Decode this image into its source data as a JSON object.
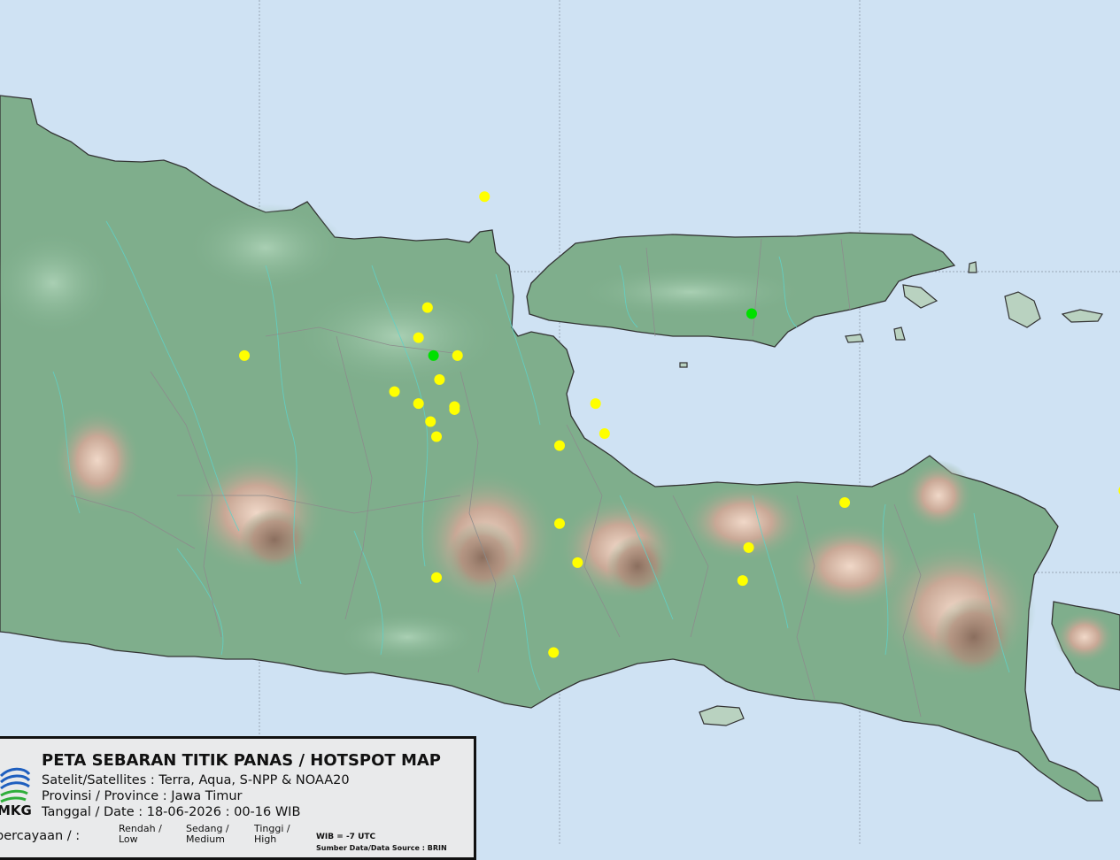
{
  "legend": {
    "title": "PETA SEBARAN TITIK PANAS / HOTSPOT MAP",
    "satellites": "Satelit/Satellites : Terra, Aqua, S-NPP & NOAA20",
    "province": "Provinsi / Province : Jawa Timur",
    "date": "Tanggal / Date : 18-06-2026 : 00-16 WIB",
    "confidence_label": "percayaan / :",
    "levels": [
      {
        "line1": "Rendah /",
        "line2": "Low"
      },
      {
        "line1": "Sedang /",
        "line2": "Medium"
      },
      {
        "line1": "Tinggi /",
        "line2": "High"
      }
    ],
    "timezone_note": "WIB = -7 UTC",
    "source_partial": "Sumber Data/Data Source : BRIN",
    "logo_text": "MKG"
  },
  "colors": {
    "sea": "#cfe2f3",
    "land": "#7fae8c",
    "river": "#5fd2c8",
    "hotspot_medium": "#ffff00",
    "hotspot_low": "#00e000",
    "coast": "#333333"
  },
  "hotspots": [
    {
      "lon": 111.75,
      "lat": -6.75,
      "level": "medium"
    },
    {
      "lon": 111.56,
      "lat": -7.12,
      "level": "medium"
    },
    {
      "lon": 111.53,
      "lat": -7.22,
      "level": "medium"
    },
    {
      "lon": 111.58,
      "lat": -7.28,
      "level": "low"
    },
    {
      "lon": 111.66,
      "lat": -7.28,
      "level": "medium"
    },
    {
      "lon": 111.6,
      "lat": -7.36,
      "level": "medium"
    },
    {
      "lon": 111.45,
      "lat": -7.4,
      "level": "medium"
    },
    {
      "lon": 111.53,
      "lat": -7.44,
      "level": "medium"
    },
    {
      "lon": 111.65,
      "lat": -7.45,
      "level": "medium"
    },
    {
      "lon": 111.65,
      "lat": -7.46,
      "level": "medium"
    },
    {
      "lon": 111.57,
      "lat": -7.5,
      "level": "medium"
    },
    {
      "lon": 111.59,
      "lat": -7.55,
      "level": "medium"
    },
    {
      "lon": 110.95,
      "lat": -7.28,
      "level": "medium"
    },
    {
      "lon": 112.12,
      "lat": -7.44,
      "level": "medium"
    },
    {
      "lon": 112.15,
      "lat": -7.54,
      "level": "medium"
    },
    {
      "lon": 112.0,
      "lat": -7.58,
      "level": "medium"
    },
    {
      "lon": 112.0,
      "lat": -7.84,
      "level": "medium"
    },
    {
      "lon": 112.06,
      "lat": -7.97,
      "level": "medium"
    },
    {
      "lon": 111.59,
      "lat": -8.02,
      "level": "medium"
    },
    {
      "lon": 111.98,
      "lat": -8.27,
      "level": "medium"
    },
    {
      "lon": 112.63,
      "lat": -7.92,
      "level": "medium"
    },
    {
      "lon": 112.61,
      "lat": -8.03,
      "level": "medium"
    },
    {
      "lon": 112.95,
      "lat": -7.77,
      "level": "medium"
    },
    {
      "lon": 112.64,
      "lat": -7.14,
      "level": "low"
    },
    {
      "lon": 113.88,
      "lat": -7.73,
      "level": "medium"
    },
    {
      "lon": 113.9,
      "lat": -7.71,
      "level": "medium"
    },
    {
      "lon": 113.93,
      "lat": -7.72,
      "level": "medium"
    },
    {
      "lon": 113.94,
      "lat": -7.76,
      "level": "medium"
    },
    {
      "lon": 114.05,
      "lat": -7.74,
      "level": "medium"
    }
  ]
}
